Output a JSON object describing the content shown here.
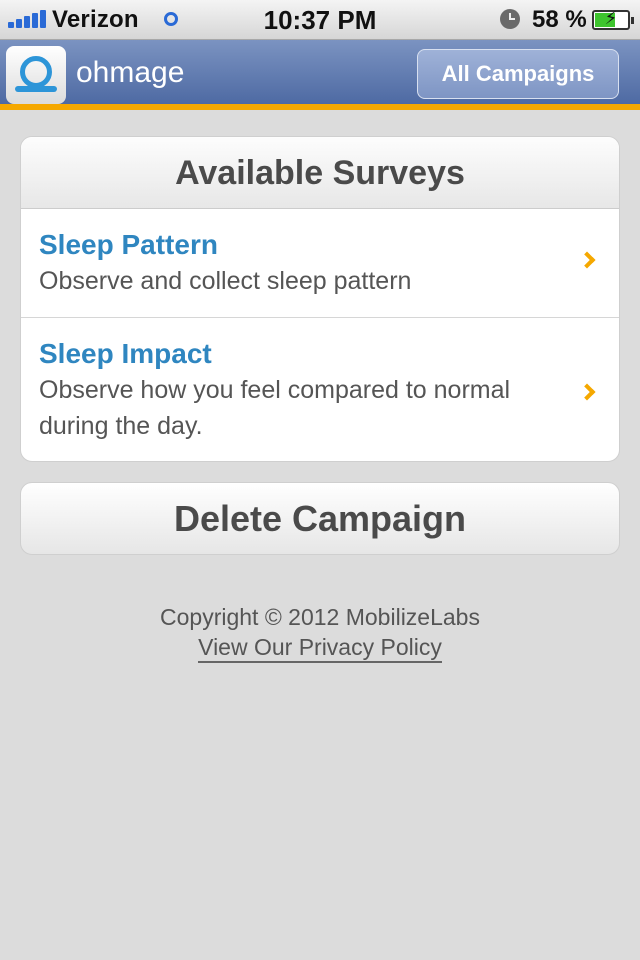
{
  "status_bar": {
    "carrier": "Verizon",
    "time": "10:37 PM",
    "battery_percent_label": "58 %",
    "battery_level": 0.58,
    "icons": [
      "signal-bars-icon",
      "wifi-icon",
      "alarm-clock-icon",
      "battery-charging-icon"
    ]
  },
  "nav": {
    "app_name": "ohmage",
    "all_campaigns_label": "All Campaigns"
  },
  "surveys": {
    "header": "Available Surveys",
    "items": [
      {
        "title": "Sleep Pattern",
        "description": "Observe and collect sleep pattern"
      },
      {
        "title": "Sleep Impact",
        "description": "Observe how you feel compared to normal during the day."
      }
    ]
  },
  "delete_label": "Delete Campaign",
  "footer": {
    "copyright": "Copyright © 2012 MobilizeLabs",
    "privacy_link": "View Our Privacy Policy"
  },
  "colors": {
    "nav_background": "#5f79af",
    "accent_orange": "#f5a800",
    "survey_title_blue": "#2f86c0",
    "page_background": "#dcdcdc"
  }
}
